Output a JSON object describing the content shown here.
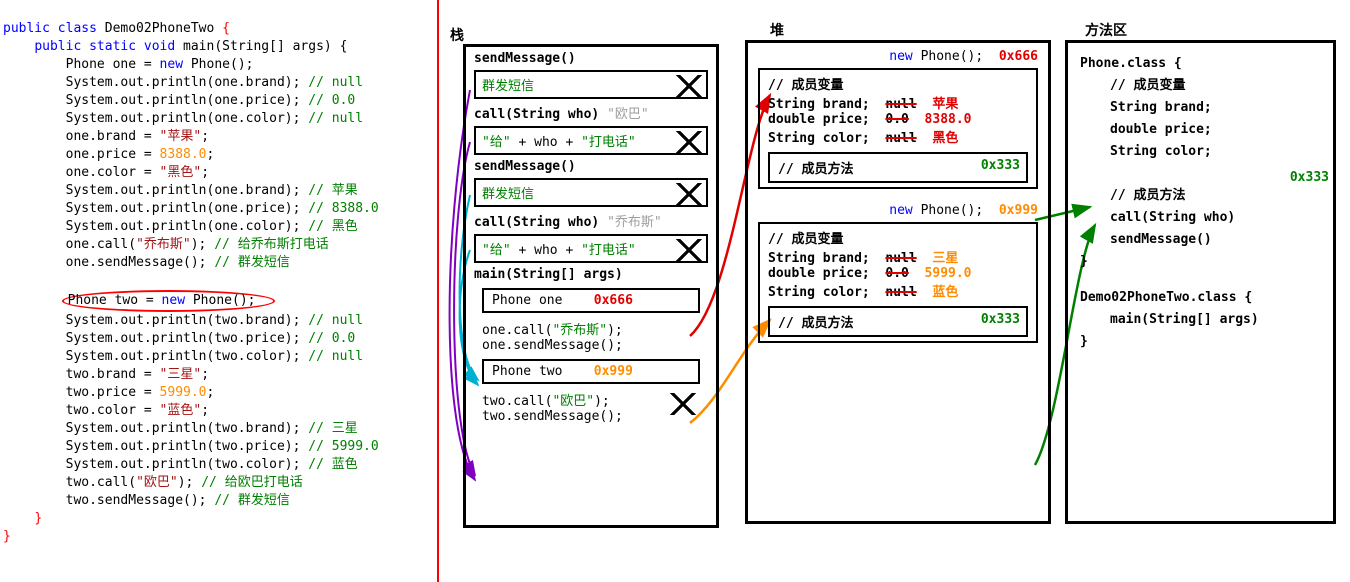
{
  "code": {
    "l1a": "public class",
    "l1b": "Demo02PhoneTwo",
    "l1c": "{",
    "l2a": "public static void",
    "l2b": "main",
    "l2c": "(String[] args) {",
    "l3a": "Phone one = ",
    "l3b": "new",
    "l3c": " Phone();",
    "l4": "System.out.println(one.brand);",
    "l4c": " // null",
    "l5": "System.out.println(one.price);",
    "l5c": " // 0.0",
    "l6": "System.out.println(one.color);",
    "l6c": " // null",
    "l7a": "one.brand = ",
    "l7b": "\"苹果\"",
    "l7c": ";",
    "l8a": "one.price = ",
    "l8b": "8388.0",
    "l8c": ";",
    "l9a": "one.color = ",
    "l9b": "\"黑色\"",
    "l9c": ";",
    "l10": "System.out.println(one.brand);",
    "l10c": " // 苹果",
    "l11": "System.out.println(one.price);",
    "l11c": " // 8388.0",
    "l12": "System.out.println(one.color);",
    "l12c": " // 黑色",
    "l13a": "one.call(",
    "l13b": "\"乔布斯\"",
    "l13c": ");",
    "l13d": " // 给乔布斯打电话",
    "l14a": "one.sendMessage();",
    "l14c": " // 群发短信",
    "l16a": "Phone two = ",
    "l16b": "new",
    "l16c": " Phone();",
    "l17": "System.out.println(two.brand);",
    "l17c": " // null",
    "l18": "System.out.println(two.price);",
    "l18c": " // 0.0",
    "l19": "System.out.println(two.color);",
    "l19c": " // null",
    "l20a": "two.brand = ",
    "l20b": "\"三星\"",
    "l20c": ";",
    "l21a": "two.price = ",
    "l21b": "5999.0",
    "l21c": ";",
    "l22a": "two.color = ",
    "l22b": "\"蓝色\"",
    "l22c": ";",
    "l23": "System.out.println(two.brand);",
    "l23c": " // 三星",
    "l24": "System.out.println(two.price);",
    "l24c": " // 5999.0",
    "l25": "System.out.println(two.color);",
    "l25c": " // 蓝色",
    "l26a": "two.call(",
    "l26b": "\"欧巴\"",
    "l26c": ");",
    "l26d": " // 给欧巴打电话",
    "l27a": "two.sendMessage();",
    "l27c": " // 群发短信",
    "l28": "}",
    "l29": "}"
  },
  "headers": {
    "stack": "栈",
    "heap": "堆",
    "method_area": "方法区"
  },
  "stack": {
    "f1": "sendMessage()",
    "f1t": "群发短信",
    "f2": "call(String who)",
    "f2arg": "\"欧巴\"",
    "f2t1": "\"给\"",
    "f2t2": " + who + ",
    "f2t3": "\"打电话\"",
    "f3": "sendMessage()",
    "f3t": "群发短信",
    "f4": "call(String who)",
    "f4arg": "\"乔布斯\"",
    "f4t1": "\"给\"",
    "f4t2": " + who + ",
    "f4t3": "\"打电话\"",
    "main": "main(String[] args)",
    "var1": "Phone one",
    "addr1": "0x666",
    "call1a": "one.call(",
    "call1b": "\"乔布斯\"",
    "call1c": ");",
    "call1d": "one.sendMessage();",
    "var2": "Phone two",
    "addr2": "0x999",
    "call2a": "two.call(",
    "call2b": "\"欧巴\"",
    "call2c": ");",
    "call2d": "two.sendMessage();"
  },
  "heap": {
    "new1": "new",
    "phone1": " Phone();",
    "addr1": "0x666",
    "memvar": "// 成员变量",
    "brand": "String brand;",
    "old_null": "null",
    "apple": "苹果",
    "price": "double price;",
    "old_zero": "0.0",
    "p1": "8388.0",
    "color": "String color;",
    "black": "黑色",
    "memmethod": "// 成员方法",
    "methodAddr": "0x333",
    "new2": "new",
    "phone2": " Phone();",
    "addr2": "0x999",
    "samsung": "三星",
    "p2": "5999.0",
    "blue": "蓝色"
  },
  "method_area": {
    "phone_class": "Phone.class {",
    "memvar": "// 成员变量",
    "brand": "String brand;",
    "price": "double price;",
    "color": "String color;",
    "addr": "0x333",
    "memmethod": "// 成员方法",
    "call": "call(String who)",
    "send": "sendMessage()",
    "cb": "}",
    "demo": "Demo02PhoneTwo.class {",
    "main": "main(String[] args)",
    "cb2": "}"
  },
  "chart_data": {
    "type": "diagram",
    "description": "Java memory diagram: left=source code, stack (栈) frames, heap (堆) objects, method area (方法区) class definitions, with arrows showing references.",
    "stack_frames": [
      {
        "name": "sendMessage()",
        "body": "群发短信",
        "popped": true
      },
      {
        "name": "call(String who)",
        "arg": "欧巴",
        "body": "\"给\" + who + \"打电话\"",
        "popped": true
      },
      {
        "name": "sendMessage()",
        "body": "群发短信",
        "popped": true
      },
      {
        "name": "call(String who)",
        "arg": "乔布斯",
        "body": "\"给\" + who + \"打电话\"",
        "popped": true
      },
      {
        "name": "main(String[] args)",
        "locals": [
          {
            "name": "Phone one",
            "ref": "0x666"
          },
          {
            "name": "Phone two",
            "ref": "0x999"
          }
        ],
        "calls": [
          "one.call(\"乔布斯\")",
          "one.sendMessage()",
          "two.call(\"欧巴\")",
          "two.sendMessage()"
        ]
      }
    ],
    "heap_objects": [
      {
        "addr": "0x666",
        "type": "Phone",
        "fields": {
          "brand": {
            "old": "null",
            "new": "苹果"
          },
          "price": {
            "old": "0.0",
            "new": 8388.0
          },
          "color": {
            "old": "null",
            "new": "黑色"
          }
        },
        "method_ptr": "0x333"
      },
      {
        "addr": "0x999",
        "type": "Phone",
        "fields": {
          "brand": {
            "old": "null",
            "new": "三星"
          },
          "price": {
            "old": "0.0",
            "new": 5999.0
          },
          "color": {
            "old": "null",
            "new": "蓝色"
          }
        },
        "method_ptr": "0x333"
      }
    ],
    "method_area": [
      {
        "class": "Phone.class",
        "fields": [
          "String brand",
          "double price",
          "String color"
        ],
        "methods_addr": "0x333",
        "methods": [
          "call(String who)",
          "sendMessage()"
        ]
      },
      {
        "class": "Demo02PhoneTwo.class",
        "methods": [
          "main(String[] args)"
        ]
      }
    ],
    "arrows": [
      {
        "from": "stack:Phone one 0x666",
        "to": "heap:0x666",
        "color": "red"
      },
      {
        "from": "stack:Phone two 0x999",
        "to": "heap:0x999",
        "color": "orange"
      },
      {
        "from": "heap:0x666 方法 0x333",
        "to": "method_area:0x333",
        "color": "green"
      },
      {
        "from": "heap:0x999 方法 0x333",
        "to": "method_area:0x333",
        "color": "green"
      },
      {
        "from": "stack call frames",
        "to": "method_area methods",
        "color": "purple,cyan"
      }
    ]
  }
}
